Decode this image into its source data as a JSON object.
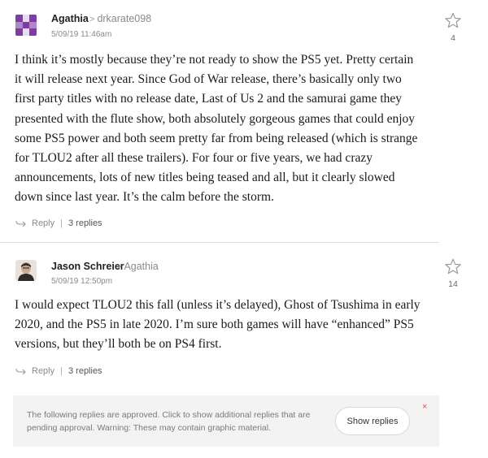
{
  "comments": [
    {
      "author": "Agathia",
      "reply_to": "drkarate098",
      "timestamp": "5/09/19 11:46am",
      "likes": "4",
      "body_lines": [
        "I think it’s mostly because they’re not ready to show the PS5 yet. Pretty certain",
        "it will release next year. Since God of War release, there’s basically only two",
        "first party titles with no release date, Last of Us 2 and the samurai game they",
        "presented with the flute show, both absolutely gorgeous games that could enjoy",
        "some PS5 power and both seem pretty far from being released (which is strange",
        "for TLOU2 after all these trailers). For four or five years, we had crazy",
        "announcements, lots of new titles being teased and all, but it clearly slowed",
        "down since last year. It’s the calm before the storm."
      ],
      "reply_label": "Reply",
      "replies_label": "3 replies",
      "avatar_colors": [
        "#7b3fa0",
        "#b085c9"
      ]
    },
    {
      "author": "Jason Schreier",
      "reply_to": "Agathia",
      "timestamp": "5/09/19 12:50pm",
      "likes": "14",
      "body_lines": [
        "I would expect TLOU2 this fall (unless it’s delayed), Ghost of Tsushima in early",
        "2020, and the PS5 in late 2020. I’m sure both games will have “enhanced” PS5",
        "versions, but they’ll both be on PS4 first."
      ],
      "reply_label": "Reply",
      "replies_label": "3 replies",
      "avatar_colors": [
        "#3a2f2a",
        "#c9b29a"
      ]
    }
  ],
  "pending": {
    "text": "The following replies are approved. Click to show additional replies that are pending approval. Warning: These may contain graphic material.",
    "button_label": "Show replies",
    "close_symbol": "×"
  },
  "icons": {
    "star": "star-outline-icon",
    "reply": "reply-arrow-icon",
    "close": "close-icon"
  }
}
